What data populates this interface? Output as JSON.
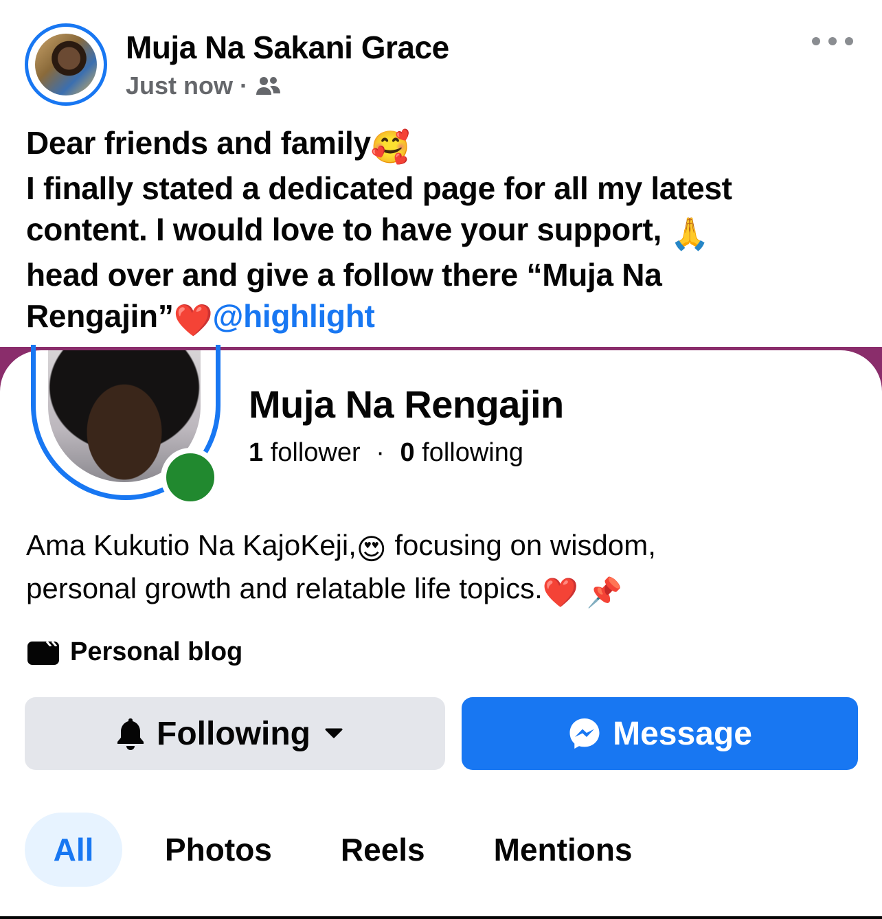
{
  "post": {
    "author_name": "Muja Na Sakani Grace",
    "timestamp": "Just now",
    "separator": "·",
    "audience_icon": "friends-icon",
    "more_icon": "more-options-icon",
    "text_lines": [
      "Dear friends and family",
      "I finally stated a dedicated page for all my latest",
      "content. I would love to have your support,",
      "head over and give a follow there “Muja Na",
      "Rengajin”"
    ],
    "emoji_smiling_hearts": "🥰",
    "emoji_pray": "🙏",
    "emoji_heart": "❤️",
    "mention": "@highlight"
  },
  "page_card": {
    "name": "Muja Na Rengajin",
    "followers_count": "1",
    "followers_label": "follower",
    "stats_separator": "·",
    "following_count": "0",
    "following_label": "following",
    "online_status": "online",
    "bio_line_1_a": "Ama Kukutio Na KajoKeji,",
    "bio_emoji_heart_eyes": "😍",
    "bio_line_1_b": "focusing on wisdom,",
    "bio_line_2": "personal growth and relatable life topics.",
    "bio_emoji_heart": "❤️",
    "bio_emoji_pin": "📌",
    "category": "Personal blog",
    "category_icon": "video-clip-icon",
    "following_button": "Following",
    "following_icon": "bell-icon",
    "following_caret_icon": "caret-down-icon",
    "message_button": "Message",
    "message_icon": "messenger-icon",
    "tabs": [
      {
        "label": "All",
        "active": true
      },
      {
        "label": "Photos",
        "active": false
      },
      {
        "label": "Reels",
        "active": false
      },
      {
        "label": "Mentions",
        "active": false
      }
    ]
  },
  "colors": {
    "accent": "#1877f2",
    "secondary_text": "#65676b",
    "button_gray": "#e4e6eb",
    "online_green": "#21892f",
    "active_tab_bg": "#e7f3ff"
  }
}
